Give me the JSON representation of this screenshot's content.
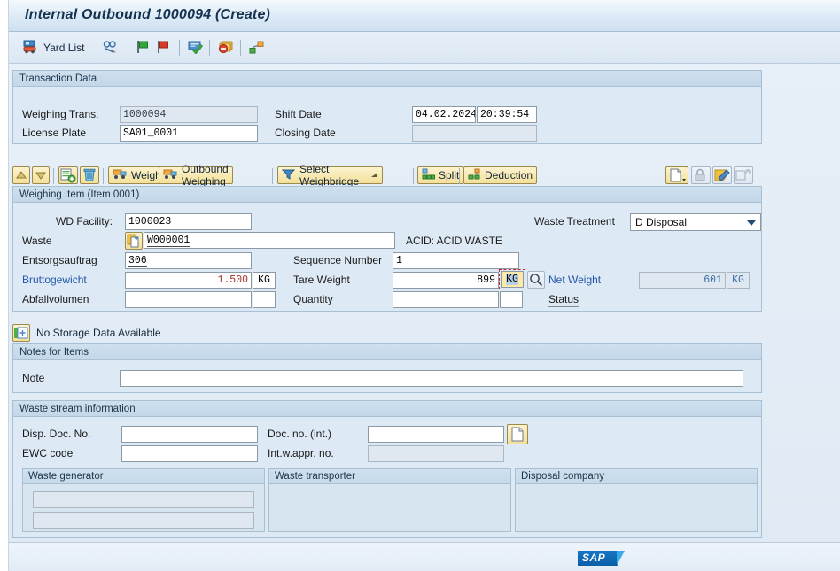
{
  "window": {
    "title": "Internal Outbound 1000094 (Create)"
  },
  "toolbar": {
    "yard_list": "Yard List",
    "icons": [
      {
        "name": "yard-list-truck-icon"
      },
      {
        "name": "glasses-pencil-icon"
      },
      {
        "name": "green-flag-icon"
      },
      {
        "name": "red-flag-icon"
      },
      {
        "name": "card-check-icon"
      },
      {
        "name": "no-entry-stack-icon"
      },
      {
        "name": "link-nodes-icon"
      }
    ]
  },
  "transaction": {
    "title": "Transaction Data",
    "weighing_trans_label": "Weighing Trans.",
    "weighing_trans_value": "1000094",
    "license_plate_label": "License Plate",
    "license_plate_value": "SA01_0001",
    "shift_date_label": "Shift Date",
    "shift_date_value": "04.02.2024",
    "shift_time_value": "20:39:54",
    "closing_date_label": "Closing Date",
    "closing_date_value": ""
  },
  "item_toolbar": {
    "up": "▲",
    "down": "▼",
    "weigh": "Weigh",
    "outbound_weighing": "Outbound Weighing",
    "select_weighbridge": "Select Weighbridge",
    "split": "Split",
    "deduction": "Deduction"
  },
  "item": {
    "title": "Weighing Item (Item 0001)",
    "wd_facility_label": "WD Facility:",
    "wd_facility_value": "1000023",
    "waste_label": "Waste",
    "waste_value": "W000001",
    "waste_desc": "ACID: ACID WASTE",
    "entsorgsauftrag_label": "Entsorgsauftrag",
    "entsorgsauftrag_value": "306",
    "sequence_number_label": "Sequence Number",
    "sequence_number_value": "1",
    "bruttogewicht_label": "Bruttogewicht",
    "bruttogewicht_value": "1.500",
    "bruttogewicht_unit": "KG",
    "tare_weight_label": "Tare Weight",
    "tare_weight_value": "899",
    "tare_weight_unit": "KG",
    "net_weight_label": "Net Weight",
    "net_weight_value": "601",
    "net_weight_unit": "KG",
    "abfallvolumen_label": "Abfallvolumen",
    "abfallvolumen_value": "",
    "abfallvolumen_unit": "",
    "quantity_label": "Quantity",
    "quantity_value": "",
    "quantity_unit": "",
    "status_label": "Status",
    "waste_treatment_label": "Waste Treatment",
    "waste_treatment_value": "D Disposal"
  },
  "storage": {
    "message": "No Storage Data Available"
  },
  "notes": {
    "title": "Notes for Items",
    "note_label": "Note",
    "note_value": ""
  },
  "waste_stream": {
    "title": "Waste stream information",
    "disp_doc_no_label": "Disp. Doc. No.",
    "disp_doc_no_value": "",
    "ewc_code_label": "EWC code",
    "ewc_code_value": "",
    "doc_no_int_label": "Doc. no. (int.)",
    "doc_no_int_value": "",
    "int_w_appr_no_label": "Int.w.appr. no.",
    "int_w_appr_no_value": "",
    "groups": [
      {
        "title": "Waste generator",
        "fields": [
          "",
          ""
        ]
      },
      {
        "title": "Waste transporter",
        "fields": [
          "",
          ""
        ]
      },
      {
        "title": "Disposal company",
        "fields": [
          "",
          ""
        ]
      }
    ]
  },
  "footer": {
    "logo_text": "SAP"
  }
}
